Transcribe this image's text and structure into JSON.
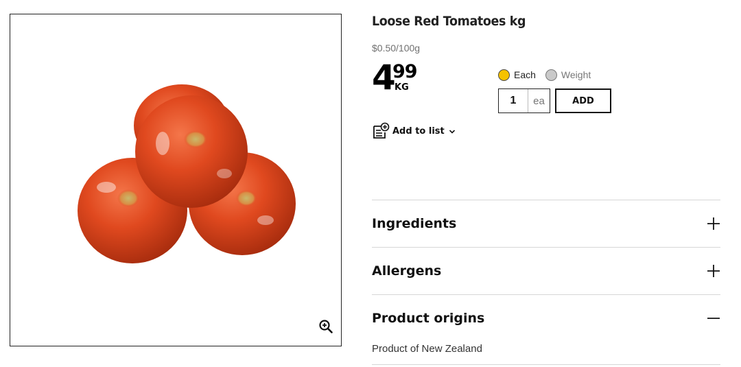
{
  "product": {
    "title": "Loose Red Tomatoes kg",
    "unit_price": "$0.50/100g",
    "price_dollars": "4",
    "price_cents": "99",
    "price_unit": "KG"
  },
  "purchase": {
    "options": [
      {
        "label": "Each",
        "selected": true
      },
      {
        "label": "Weight",
        "selected": false
      }
    ],
    "quantity": "1",
    "quantity_unit": "ea",
    "add_label": "ADD"
  },
  "list": {
    "add_to_list_label": "Add to list"
  },
  "accordion": [
    {
      "title": "Ingredients",
      "expanded": false
    },
    {
      "title": "Allergens",
      "expanded": false
    },
    {
      "title": "Product origins",
      "expanded": true,
      "content": "Product of New Zealand"
    }
  ],
  "icons": {
    "zoom": "zoom-in-icon",
    "list": "add-to-list-icon",
    "chevron": "chevron-down-icon",
    "expand": "plus-icon",
    "collapse": "minus-icon"
  },
  "colors": {
    "selected_radio": "#f6c200",
    "unselected_radio": "#c9c9c9",
    "tomato": "#e0491f"
  }
}
